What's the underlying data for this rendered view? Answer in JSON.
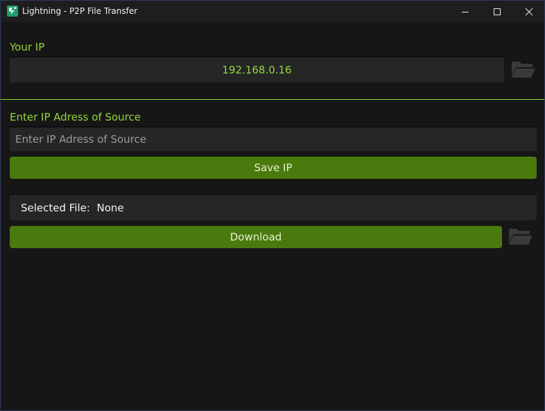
{
  "window": {
    "title": "Lightning - P2P File Transfer",
    "controls": [
      "minimize",
      "maximize",
      "close"
    ]
  },
  "your_ip": {
    "label": "Your IP",
    "value": "192.168.0.16",
    "icon": "folder-open-icon"
  },
  "source": {
    "label": "Enter IP Adress of Source",
    "input_value": "",
    "input_placeholder": "Enter IP Adress of Source",
    "save_button_label": "Save IP"
  },
  "file": {
    "selected_label": "Selected File:",
    "selected_value": "None",
    "download_button_label": "Download",
    "icon": "folder-open-icon"
  },
  "colors": {
    "accent_green": "#93d63b",
    "button_green": "#4a7a0e",
    "background": "#161616",
    "field_background": "#262626"
  }
}
